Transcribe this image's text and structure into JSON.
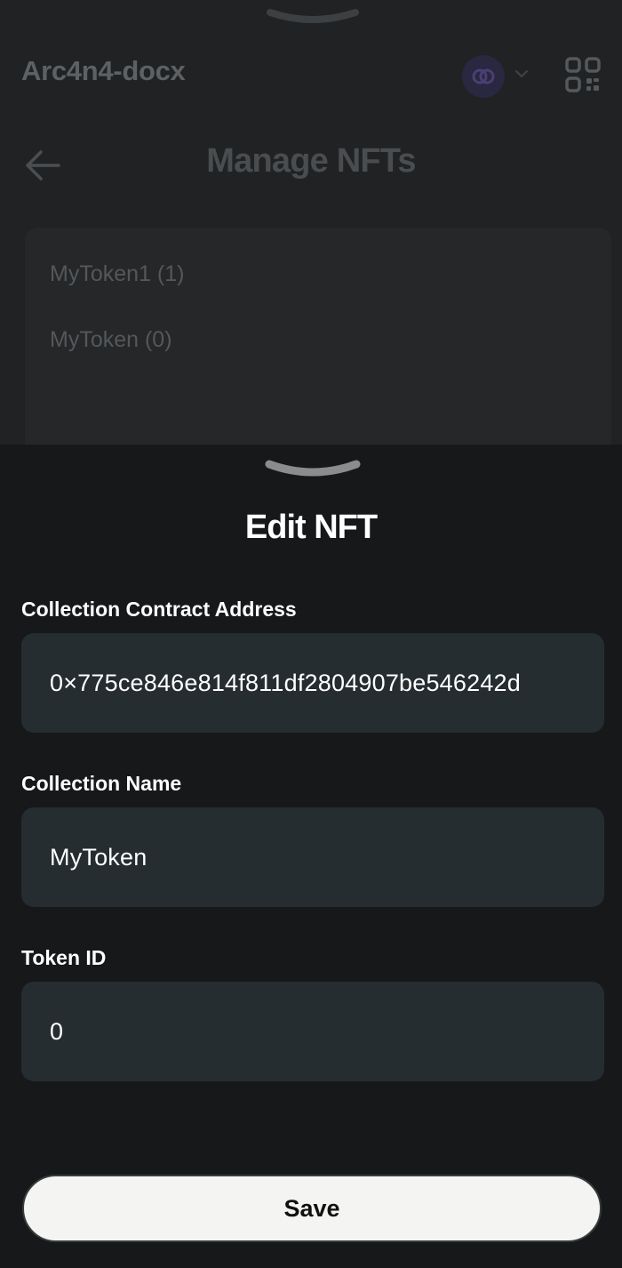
{
  "background": {
    "wallet_name": "Arc4n4-docx",
    "page_title": "Manage NFTs",
    "collections": [
      {
        "label": "MyToken1 (1)"
      },
      {
        "label": "MyToken (0)"
      }
    ],
    "icons": {
      "network": "network-logo-icon",
      "dropdown": "chevron-down-icon",
      "qr": "qr-code-icon",
      "back": "back-arrow-icon"
    }
  },
  "sheet": {
    "title": "Edit NFT",
    "fields": {
      "contract_address": {
        "label": "Collection Contract Address",
        "value": "0×775ce846e814f811df2804907be546242d"
      },
      "collection_name": {
        "label": "Collection Name",
        "value": "MyToken"
      },
      "token_id": {
        "label": "Token ID",
        "value": "0"
      }
    },
    "save_label": "Save"
  },
  "colors": {
    "sheet_bg": "#17181a",
    "input_bg": "#252d30",
    "button_bg": "#f4f4f3",
    "button_text": "#111111"
  }
}
